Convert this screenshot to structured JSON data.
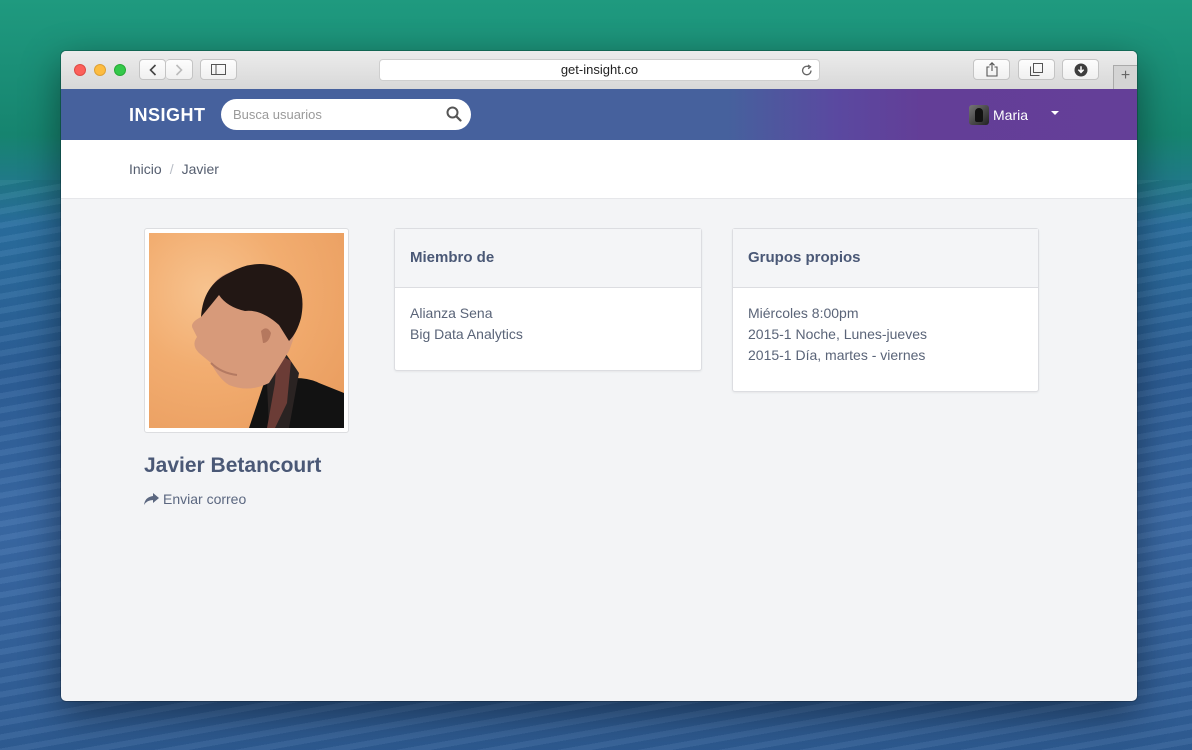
{
  "browser": {
    "url": "get-insight.co"
  },
  "navbar": {
    "brand": "INSIGHT",
    "search_placeholder": "Busca usuarios",
    "user_name": "Maria"
  },
  "breadcrumb": {
    "items": [
      "Inicio",
      "Javier"
    ]
  },
  "profile": {
    "name": "Javier Betancourt",
    "send_email_label": "Enviar correo"
  },
  "member_of": {
    "title": "Miembro de",
    "items": [
      "Alianza Sena",
      "Big Data Analytics"
    ]
  },
  "own_groups": {
    "title": "Grupos propios",
    "items": [
      "Miércoles 8:00pm",
      "2015-1 Noche, Lunes-jueves",
      "2015-1 Día, martes - viernes"
    ]
  },
  "colors": {
    "navbar_start": "#46619d",
    "navbar_end": "#643f98",
    "heading_text": "#4a5876"
  }
}
